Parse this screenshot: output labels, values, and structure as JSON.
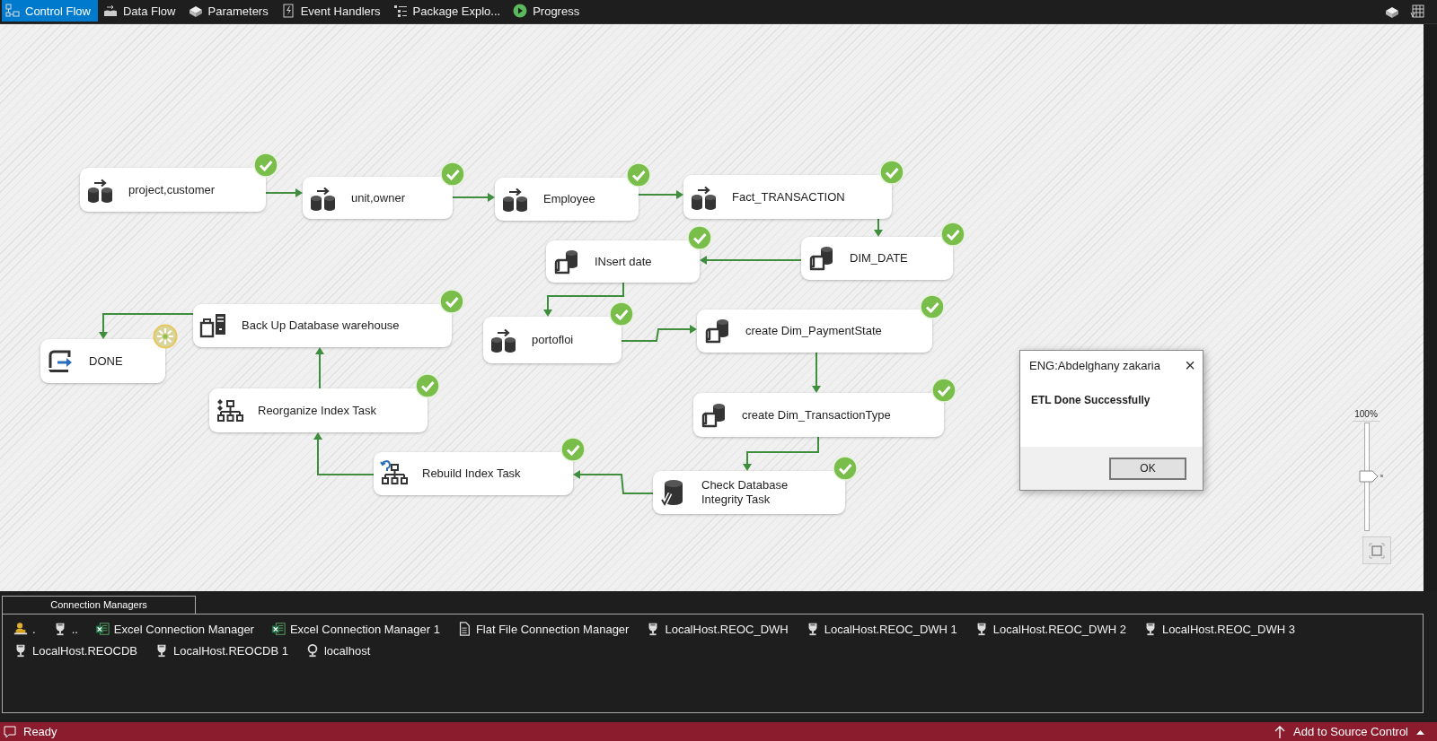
{
  "toolbar": {
    "tabs": [
      {
        "label": "Control Flow",
        "kind": "control-flow",
        "selected": true
      },
      {
        "label": "Data Flow",
        "kind": "data-flow",
        "selected": false
      },
      {
        "label": "Parameters",
        "kind": "parameters",
        "selected": false
      },
      {
        "label": "Event Handlers",
        "kind": "event-handlers",
        "selected": false
      },
      {
        "label": "Package Explo...",
        "kind": "package-explorer",
        "selected": false
      },
      {
        "label": "Progress",
        "kind": "progress",
        "selected": false
      }
    ]
  },
  "canvas": {
    "tasks": [
      {
        "label": "project,customer",
        "kind": "dataflow",
        "completed": true
      },
      {
        "label": "unit,owner",
        "kind": "dataflow",
        "completed": true
      },
      {
        "label": "Employee",
        "kind": "dataflow",
        "completed": true
      },
      {
        "label": "Fact_TRANSACTION",
        "kind": "dataflow",
        "completed": true
      },
      {
        "label": "INsert date",
        "kind": "sql",
        "completed": true
      },
      {
        "label": "DIM_DATE",
        "kind": "sql",
        "completed": true
      },
      {
        "label": "Back Up Database warehouse",
        "kind": "backup",
        "completed": true
      },
      {
        "label": "portofloi",
        "kind": "dataflow",
        "completed": true
      },
      {
        "label": "create Dim_PaymentState",
        "kind": "sql",
        "completed": true
      },
      {
        "label": "DONE",
        "kind": "process",
        "completed": false
      },
      {
        "label": "Reorganize Index Task",
        "kind": "reorganize",
        "completed": true
      },
      {
        "label": "create Dim_TransactionType",
        "kind": "sql",
        "completed": true
      },
      {
        "label": "Rebuild Index Task",
        "kind": "rebuild",
        "completed": true
      },
      {
        "label": "Check Database Integrity Task",
        "kind": "integrity",
        "completed": true
      }
    ],
    "zoom": {
      "reading": "100%",
      "level": 0.5
    }
  },
  "dialog": {
    "title": "ENG:Abdelghany zakaria",
    "close": "×",
    "message": "ETL Done Successfully",
    "button": "OK"
  },
  "connection_managers": {
    "title": "Connection Managers",
    "items": [
      {
        "label": ".",
        "kind": "smtp"
      },
      {
        "label": "..",
        "kind": "oledb"
      },
      {
        "label": "Excel Connection Manager",
        "kind": "excel"
      },
      {
        "label": "Excel Connection Manager 1",
        "kind": "excel"
      },
      {
        "label": "Flat File Connection Manager",
        "kind": "flatfile"
      },
      {
        "label": "LocalHost.REOC_DWH",
        "kind": "oledb"
      },
      {
        "label": "LocalHost.REOC_DWH 1",
        "kind": "oledb"
      },
      {
        "label": "LocalHost.REOC_DWH 2",
        "kind": "oledb"
      },
      {
        "label": "LocalHost.REOC_DWH 3",
        "kind": "oledb"
      },
      {
        "label": "LocalHost.REOCDB",
        "kind": "oledb"
      },
      {
        "label": "LocalHost.REOCDB 1",
        "kind": "oledb"
      },
      {
        "label": "localhost",
        "kind": "ado"
      }
    ]
  },
  "status_bar": {
    "text": "Ready",
    "action": "Add to Source Control"
  }
}
